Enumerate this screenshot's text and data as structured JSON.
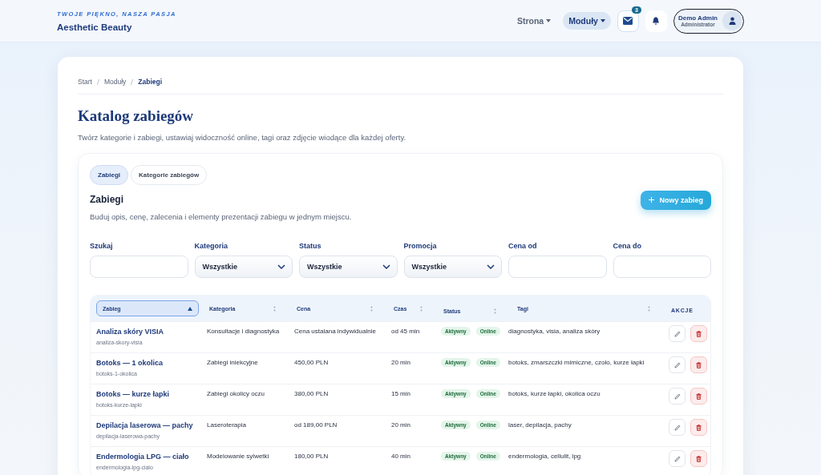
{
  "brand": {
    "tagline": "TWOJE PIĘKNO, NASZA PASJA",
    "name": "Aesthetic Beauty"
  },
  "nav": [
    {
      "label": "Strona",
      "selected": false
    },
    {
      "label": "Moduły",
      "selected": true
    }
  ],
  "messages_badge": "3",
  "user": {
    "name": "Demo Admin",
    "role": "Administrator"
  },
  "breadcrumb": [
    {
      "label": "Start",
      "selected": false
    },
    {
      "label": "Moduły",
      "selected": false
    },
    {
      "label": "Zabiegi",
      "selected": true
    }
  ],
  "page": {
    "title": "Katalog zabiegów",
    "description": "Twórz kategorie i zabiegi, ustawiaj widoczność online, tagi oraz zdjęcie wiodące dla każdej oferty."
  },
  "tabs": [
    {
      "label": "Zabiegi",
      "selected": true
    },
    {
      "label": "Kategorie zabiegów",
      "selected": false
    }
  ],
  "section": {
    "title": "Zabiegi",
    "description": "Buduj opis, cenę, zalecenia i elementy prezentacji zabiegu w jednym miejscu.",
    "new_button": "Nowy zabieg"
  },
  "filters": [
    {
      "label": "Szukaj",
      "kind": "text"
    },
    {
      "label": "Kategoria",
      "kind": "select",
      "value": "Wszystkie"
    },
    {
      "label": "Status",
      "kind": "select",
      "value": "Wszystkie"
    },
    {
      "label": "Promocja",
      "kind": "select",
      "value": "Wszystkie"
    },
    {
      "label": "Cena od",
      "kind": "text"
    },
    {
      "label": "Cena do",
      "kind": "text"
    }
  ],
  "table": {
    "columns": [
      {
        "label": "Zabieg",
        "sortable": true,
        "selected": true
      },
      {
        "label": "Kategoria",
        "sortable": true,
        "selected": false
      },
      {
        "label": "Cena",
        "sortable": true,
        "selected": false
      },
      {
        "label": "Czas",
        "sortable": true,
        "selected": false
      },
      {
        "label": "Status",
        "sortable": true,
        "selected": false
      },
      {
        "label": "Tagi",
        "sortable": true,
        "selected": false
      },
      {
        "label": "AKCJE",
        "sortable": false,
        "selected": false
      }
    ],
    "rows": [
      {
        "name": "Analiza skóry VISIA",
        "slug": "analiza-skory-visia",
        "category": "Konsultacje i diagnostyka",
        "price": "Cena ustalana indywidualnie",
        "duration": "od 45 min",
        "status": "Aktywny",
        "visibility": "Online",
        "tags": "diagnostyka, visia, analiza skóry"
      },
      {
        "name": "Botoks — 1 okolica",
        "slug": "botoks-1-okolica",
        "category": "Zabiegi iniekcyjne",
        "price": "450,00 PLN",
        "duration": "20 min",
        "status": "Aktywny",
        "visibility": "Online",
        "tags": "botoks, zmarszczki mimiczne, czoło, kurze łapki"
      },
      {
        "name": "Botoks — kurze łapki",
        "slug": "botoks-kurze-lapki",
        "category": "Zabiegi okolicy oczu",
        "price": "380,00 PLN",
        "duration": "15 min",
        "status": "Aktywny",
        "visibility": "Online",
        "tags": "botoks, kurze łapki, okolica oczu"
      },
      {
        "name": "Depilacja laserowa — pachy",
        "slug": "depilacja-laserowa-pachy",
        "category": "Laseroterapia",
        "price": "od 189,00 PLN",
        "duration": "20 min",
        "status": "Aktywny",
        "visibility": "Online",
        "tags": "laser, depilacja, pachy"
      },
      {
        "name": "Endermologia LPG — ciało",
        "slug": "endermologia-lpg-cialo",
        "category": "Modelowanie sylwetki",
        "price": "180,00 PLN",
        "duration": "40 min",
        "status": "Aktywny",
        "visibility": "Online",
        "tags": "endermologia, cellulit, lpg"
      }
    ]
  }
}
